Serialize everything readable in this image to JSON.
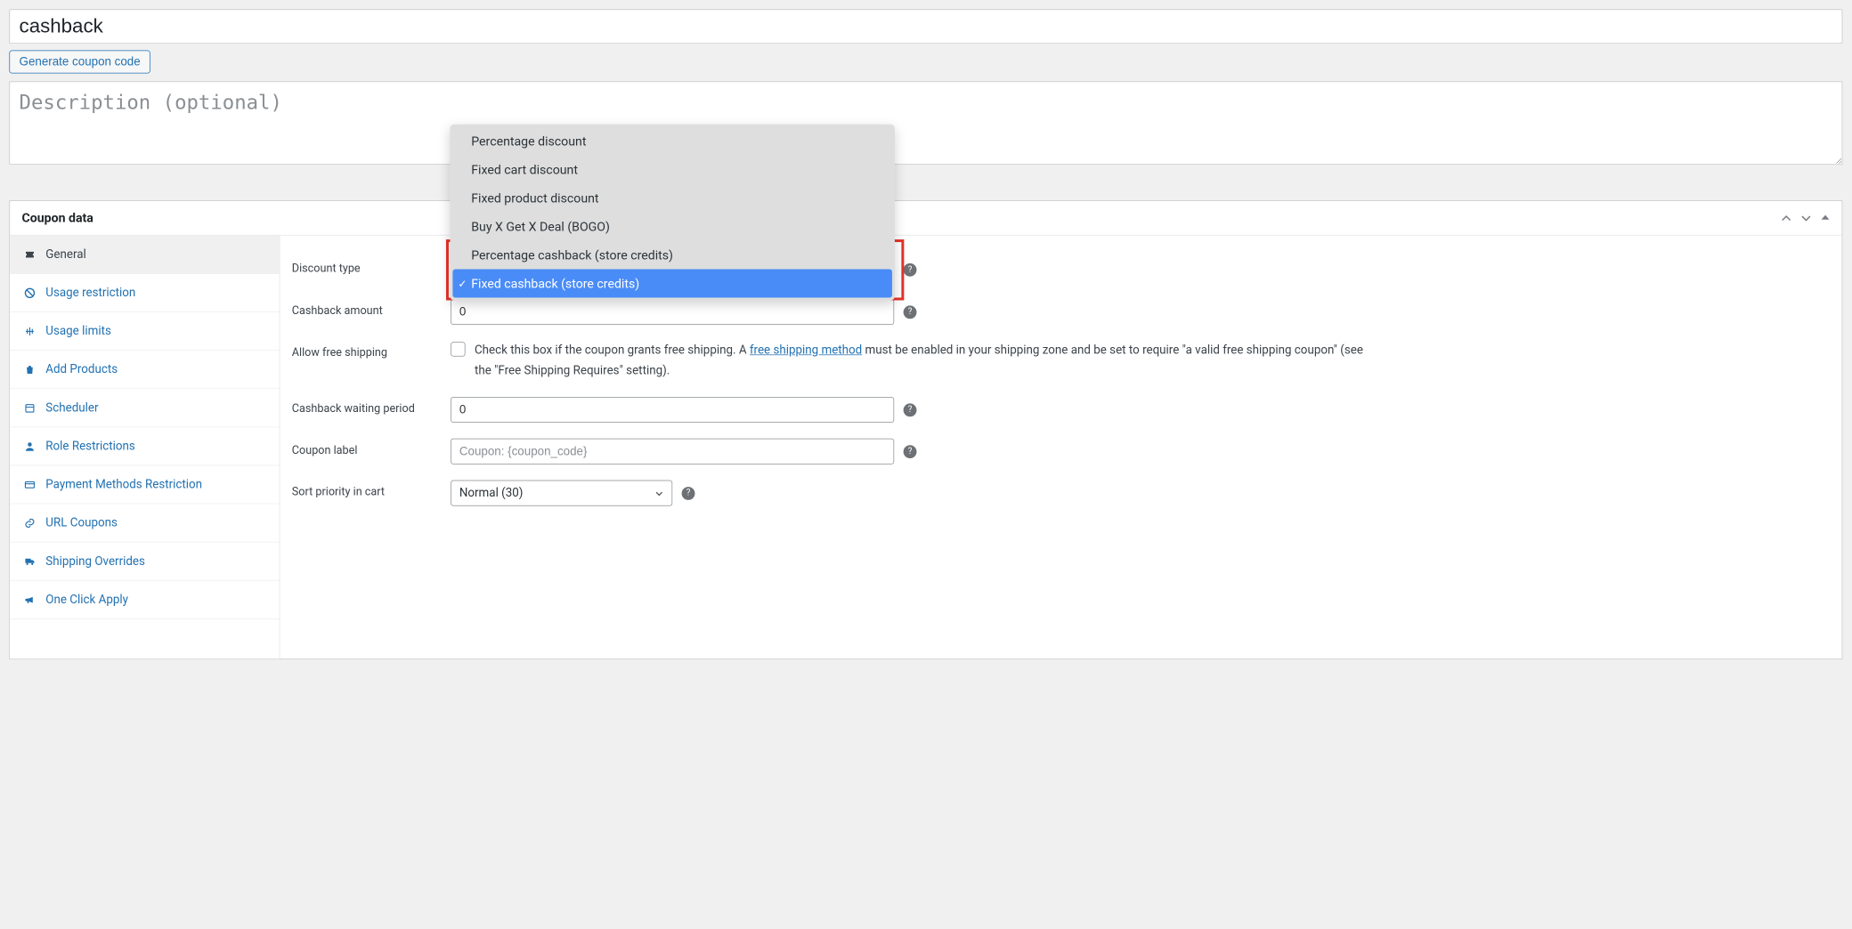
{
  "title": {
    "value": "cashback"
  },
  "generate_button": "Generate coupon code",
  "description": {
    "placeholder": "Description (optional)",
    "value": ""
  },
  "panel": {
    "title": "Coupon data",
    "toggles": {
      "up": "⌃",
      "down": "⌄",
      "collapse": "▲"
    }
  },
  "tabs": [
    {
      "key": "general",
      "label": "General",
      "active": true
    },
    {
      "key": "usage-restriction",
      "label": "Usage restriction",
      "active": false
    },
    {
      "key": "usage-limits",
      "label": "Usage limits",
      "active": false
    },
    {
      "key": "add-products",
      "label": "Add Products",
      "active": false
    },
    {
      "key": "scheduler",
      "label": "Scheduler",
      "active": false
    },
    {
      "key": "role-restrictions",
      "label": "Role Restrictions",
      "active": false
    },
    {
      "key": "payment-methods-restriction",
      "label": "Payment Methods Restriction",
      "active": false
    },
    {
      "key": "url-coupons",
      "label": "URL Coupons",
      "active": false
    },
    {
      "key": "shipping-overrides",
      "label": "Shipping Overrides",
      "active": false
    },
    {
      "key": "one-click-apply",
      "label": "One Click Apply",
      "active": false
    }
  ],
  "fields": {
    "discount_type": {
      "label": "Discount type",
      "selected": "Fixed cashback (store credits)"
    },
    "cashback_amount": {
      "label": "Cashback amount",
      "value": "0"
    },
    "allow_free_shipping": {
      "label": "Allow free shipping",
      "checked": false,
      "text_before": "Check this box if the coupon grants free shipping. A ",
      "link_text": "free shipping method",
      "text_after": " must be enabled in your shipping zone and be set to require \"a valid free shipping coupon\" (see the \"Free Shipping Requires\" setting)."
    },
    "cashback_waiting_period": {
      "label": "Cashback waiting period",
      "value": "0"
    },
    "coupon_label": {
      "label": "Coupon label",
      "placeholder": "Coupon: {coupon_code}",
      "value": ""
    },
    "sort_priority": {
      "label": "Sort priority in cart",
      "value": "Normal (30)"
    }
  },
  "dropdown": {
    "options": [
      "Percentage discount",
      "Fixed cart discount",
      "Fixed product discount",
      "Buy X Get X Deal (BOGO)",
      "Percentage cashback (store credits)",
      "Fixed cashback (store credits)"
    ],
    "selected_index": 5
  },
  "icons": {
    "general": "ticket-icon",
    "usage-restriction": "ban-icon",
    "usage-limits": "equalizer-icon",
    "add-products": "bag-icon",
    "scheduler": "calendar-icon",
    "role-restrictions": "user-icon",
    "payment-methods-restriction": "card-icon",
    "url-coupons": "link-icon",
    "shipping-overrides": "truck-icon",
    "one-click-apply": "megaphone-icon"
  }
}
